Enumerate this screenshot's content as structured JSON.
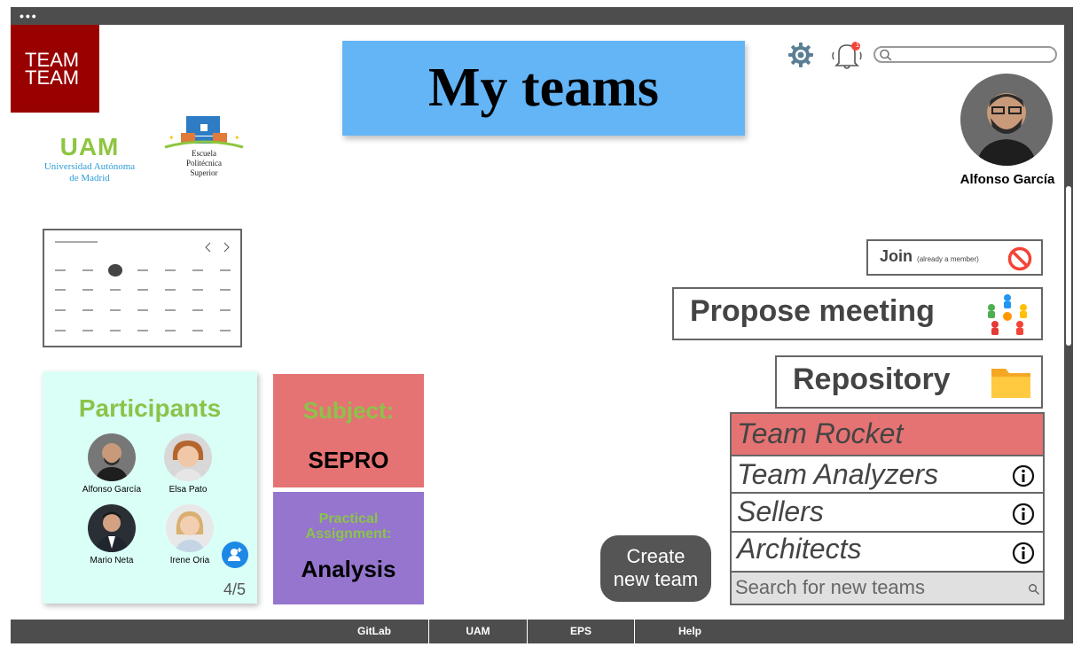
{
  "window": {
    "dots": "•••"
  },
  "logo": {
    "line1": "TEAM",
    "line2": "TEAM"
  },
  "uam": {
    "title": "UAM",
    "line1": "Universidad Autónoma",
    "line2": "de Madrid"
  },
  "eps": {
    "line1": "Escuela",
    "line2": "Politécnica",
    "line3": "Superior"
  },
  "header": {
    "title": "My teams"
  },
  "notifications": {
    "count": "1"
  },
  "search_top": {
    "placeholder": ""
  },
  "user": {
    "name": "Alfonso García"
  },
  "participants": {
    "title": "Participants",
    "people": [
      {
        "name": "Alfonso García"
      },
      {
        "name": "Elsa Pato"
      },
      {
        "name": "Mario Neta"
      },
      {
        "name": "Irene Oria"
      }
    ],
    "count": "4/5"
  },
  "subject": {
    "label": "Subject:",
    "value": "SEPRO"
  },
  "practical": {
    "label_line1": "Practical",
    "label_line2": "Assignment:",
    "value": "Analysis"
  },
  "create": {
    "line1": "Create",
    "line2": "new team"
  },
  "join": {
    "label": "Join",
    "sub": "(already a member)"
  },
  "propose": {
    "label": "Propose meeting"
  },
  "repo": {
    "label": "Repository"
  },
  "teams": {
    "items": [
      {
        "name": "Team Rocket",
        "selected": true
      },
      {
        "name": "Team Analyzers"
      },
      {
        "name": "Sellers"
      },
      {
        "name": "Architects"
      }
    ],
    "search_placeholder": "Search for new teams"
  },
  "footer": {
    "links": [
      "GitLab",
      "UAM",
      "EPS",
      "Help"
    ]
  },
  "colors": {
    "logo_bg": "#990000",
    "title_bg": "#64b5f6",
    "participants_bg": "#dafff7",
    "subject_bg": "#e57373",
    "practical_bg": "#9575cd",
    "accent_green": "#8bc34a",
    "selected_team": "#e57373",
    "frame": "#4d4d4d"
  }
}
